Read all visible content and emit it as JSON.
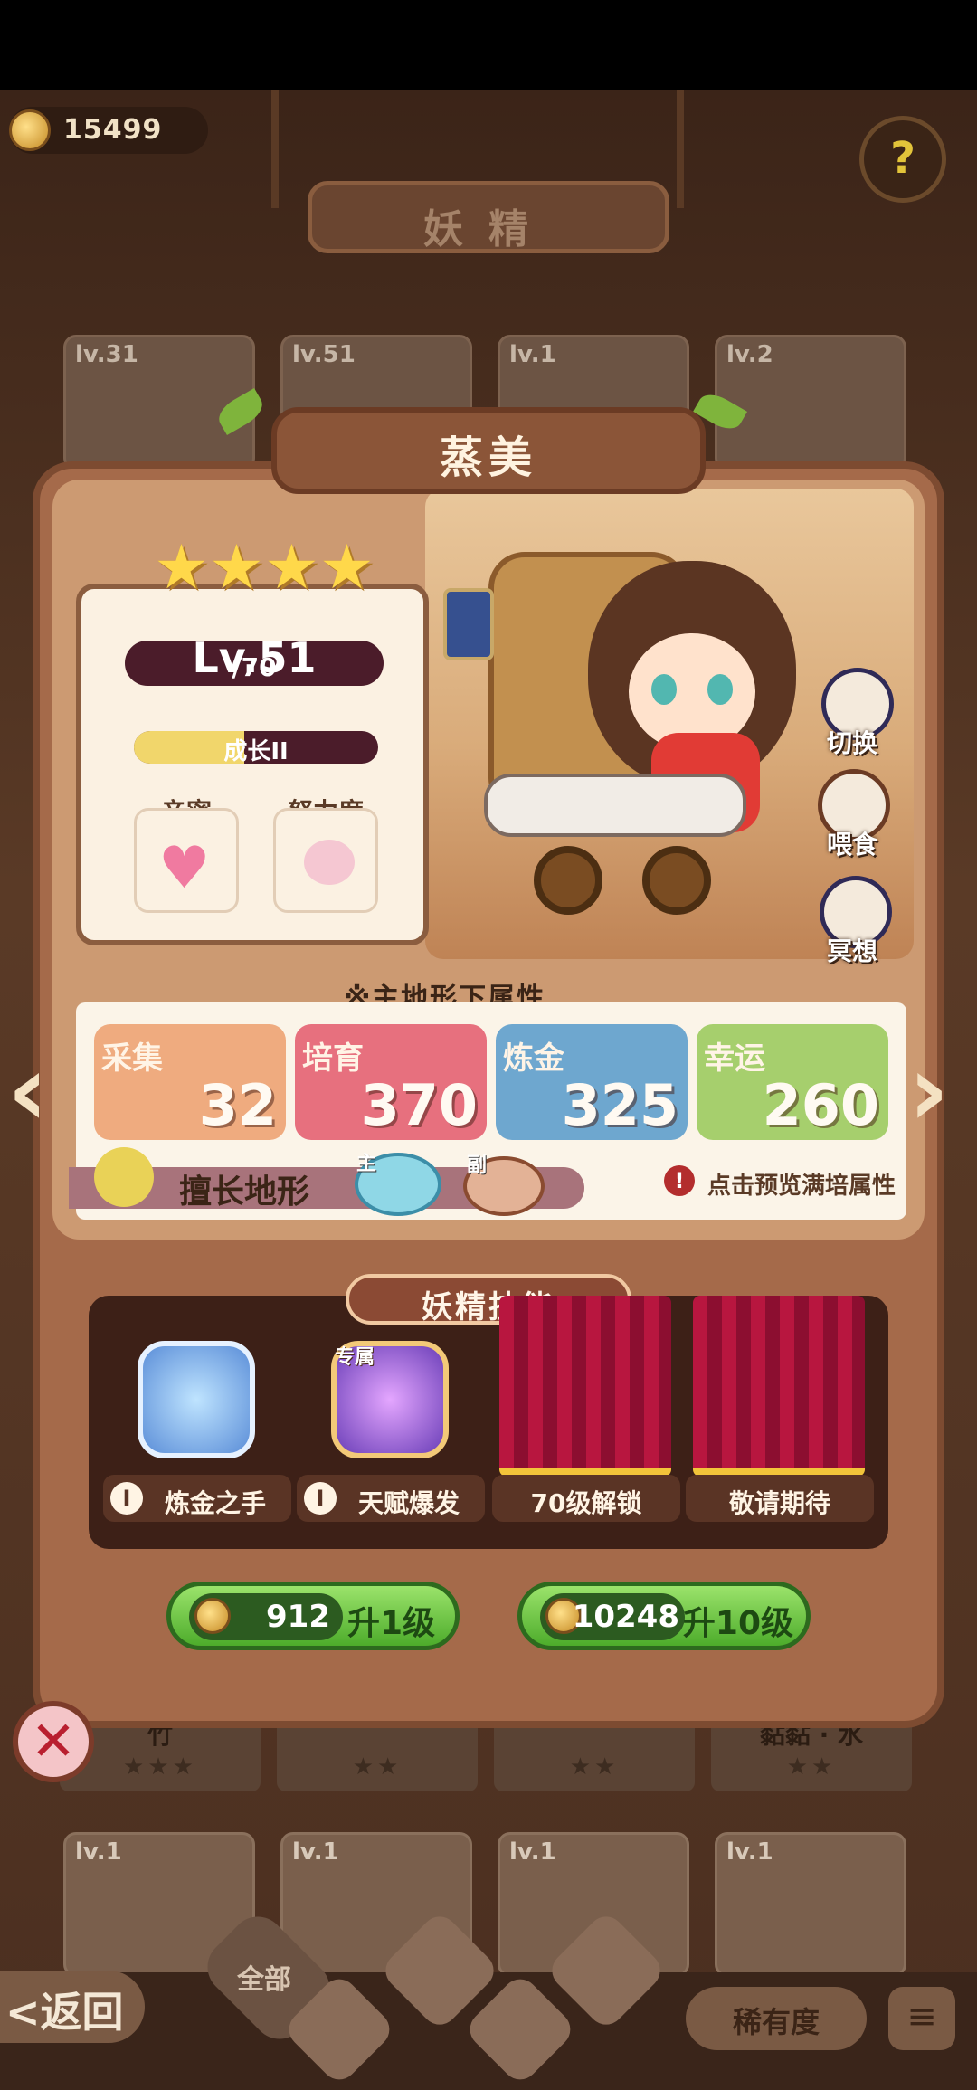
{
  "top": {
    "coins": "15499",
    "title": "妖精"
  },
  "background_cards_top": [
    {
      "level": "lv.31"
    },
    {
      "level": "lv.51"
    },
    {
      "level": "lv.1"
    },
    {
      "level": "lv.2"
    }
  ],
  "background_names": [
    {
      "name": "竹",
      "stars": "★★★"
    },
    {
      "name": "",
      "stars": "★★"
    },
    {
      "name": "",
      "stars": "★★"
    },
    {
      "name": "黏黏 · 水",
      "stars": "★★"
    }
  ],
  "background_cards_bottom": [
    {
      "level": "lv.1"
    },
    {
      "level": "lv.1"
    },
    {
      "level": "lv.1"
    },
    {
      "level": "lv.1"
    }
  ],
  "fairy": {
    "name": "蒸美",
    "stars": 4,
    "level": "Lv.51",
    "max_level": "/70",
    "growth_label": "成长II",
    "growth_fill": 0.45,
    "intimacy_label": "亲密",
    "effort_label": "努力度"
  },
  "actions": {
    "switch": "切换",
    "feed": "喂食",
    "meditate": "冥想"
  },
  "attributes": {
    "note": "※主地形下属性",
    "items": [
      {
        "name": "采集",
        "value": "32",
        "color": "#efab7f"
      },
      {
        "name": "培育",
        "value": "370",
        "color": "#e7707e"
      },
      {
        "name": "炼金",
        "value": "325",
        "color": "#6ea7cf"
      },
      {
        "name": "幸运",
        "value": "260",
        "color": "#a6cf6d"
      }
    ],
    "terrain_label": "擅长地形",
    "terrain_main": "主",
    "terrain_sub": "副",
    "preview_hint": "点击预览满培属性"
  },
  "skills": {
    "title": "妖精技能",
    "items": [
      {
        "label": "炼金之手",
        "tag": ""
      },
      {
        "label": "天赋爆发",
        "tag": "专属"
      },
      {
        "label": "70级解锁",
        "tag": ""
      },
      {
        "label": "敬请期待",
        "tag": ""
      }
    ]
  },
  "upgrade": {
    "one": {
      "cost": "912",
      "label": "升1级"
    },
    "ten": {
      "cost": "10248",
      "label": "升10级"
    }
  },
  "bottom": {
    "back": "<返回",
    "all": "全部",
    "rarity": "稀有度",
    "sort_icon": "≡"
  },
  "icons": {
    "close": "✕",
    "help": "?",
    "prev": "‹",
    "next": "›",
    "info": "I",
    "warn": "!"
  }
}
